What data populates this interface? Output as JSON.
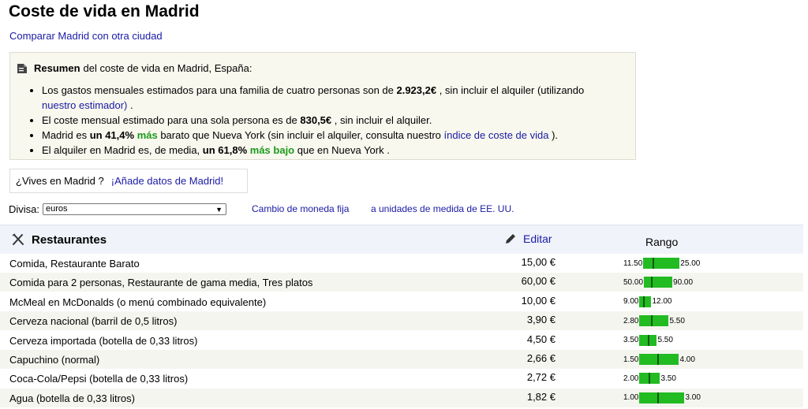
{
  "title": "Coste de vida en Madrid",
  "compare_link": "Comparar Madrid con otra ciudad",
  "summary": {
    "heading_bold": "Resumen",
    "heading_rest": "del coste de vida en Madrid, España:",
    "b1_pre": "Los gastos mensuales estimados para una familia de cuatro personas son de ",
    "b1_value": "2.923,2€",
    "b1_post": " , sin incluir el alquiler (utilizando ",
    "b1_link": "nuestro estimador)",
    "b1_end": " .",
    "b2_pre": "El coste mensual estimado para una sola persona es de ",
    "b2_value": "830,5€",
    "b2_post": " , sin incluir el alquiler.",
    "b3_pre": "Madrid es ",
    "b3_pct": "un 41,4%",
    "b3_more": "más",
    "b3_mid": " barato que Nueva York (sin incluir el alquiler, consulta nuestro ",
    "b3_link": "índice de coste de vida",
    "b3_end": " ).",
    "b4_pre": "El alquiler en Madrid es, de media, ",
    "b4_pct": "un 61,8%",
    "b4_more": "más bajo",
    "b4_post": " que en Nueva York ."
  },
  "lives": {
    "question": "¿Vives en Madrid ?",
    "link": "¡Añade datos de Madrid!"
  },
  "currency": {
    "label": "Divisa:",
    "selected": "euros",
    "fixed_link": "Cambio de moneda fija",
    "units_link": "a unidades de medida de EE. UU."
  },
  "table": {
    "category": "Restaurantes",
    "edit_label": "Editar",
    "range_header": "Rango",
    "rows": [
      {
        "name": "Comida, Restaurante Barato",
        "price": "15,00 €",
        "lo": "11.50",
        "hi": "25.00",
        "mark": 0.26
      },
      {
        "name": "Comida para 2 personas, Restaurante de gama media, Tres platos",
        "price": "60,00 €",
        "lo": "50.00",
        "hi": "90.00",
        "mark": 0.25
      },
      {
        "name": "McMeal en McDonalds (o menú combinado equivalente)",
        "price": "10,00 €",
        "lo": "9.00",
        "hi": "12.00",
        "mark": 0.33
      },
      {
        "name": "Cerveza nacional (barril de 0,5 litros)",
        "price": "3,90 €",
        "lo": "2.80",
        "hi": "5.50",
        "mark": 0.41
      },
      {
        "name": "Cerveza importada (botella de 0,33 litros)",
        "price": "4,50 €",
        "lo": "3.50",
        "hi": "5.50",
        "mark": 0.5
      },
      {
        "name": "Capuchino (normal)",
        "price": "2,66 €",
        "lo": "1.50",
        "hi": "4.00",
        "mark": 0.46
      },
      {
        "name": "Coca-Cola/Pepsi (botella de 0,33 litros)",
        "price": "2,72 €",
        "lo": "2.00",
        "hi": "3.50",
        "mark": 0.48
      },
      {
        "name": "Agua (botella de 0,33 litros)",
        "price": "1,82 €",
        "lo": "1.00",
        "hi": "3.00",
        "mark": 0.41
      }
    ]
  }
}
